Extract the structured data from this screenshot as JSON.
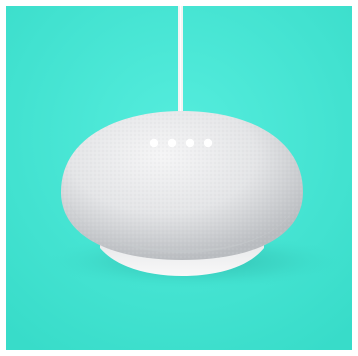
{
  "image": {
    "subject": "smart-speaker",
    "colors": {
      "background": "#3fe3d2",
      "background_light": "#52ecdc",
      "speaker_fabric": "#e9e9ea",
      "speaker_shade": "#bfc1c4",
      "speaker_base": "#f4f4f4",
      "cable": "#f7f7f7",
      "indicator_light": "#ffffff",
      "shadow": "#27b9aa"
    },
    "indicator_lights_count": 4
  }
}
